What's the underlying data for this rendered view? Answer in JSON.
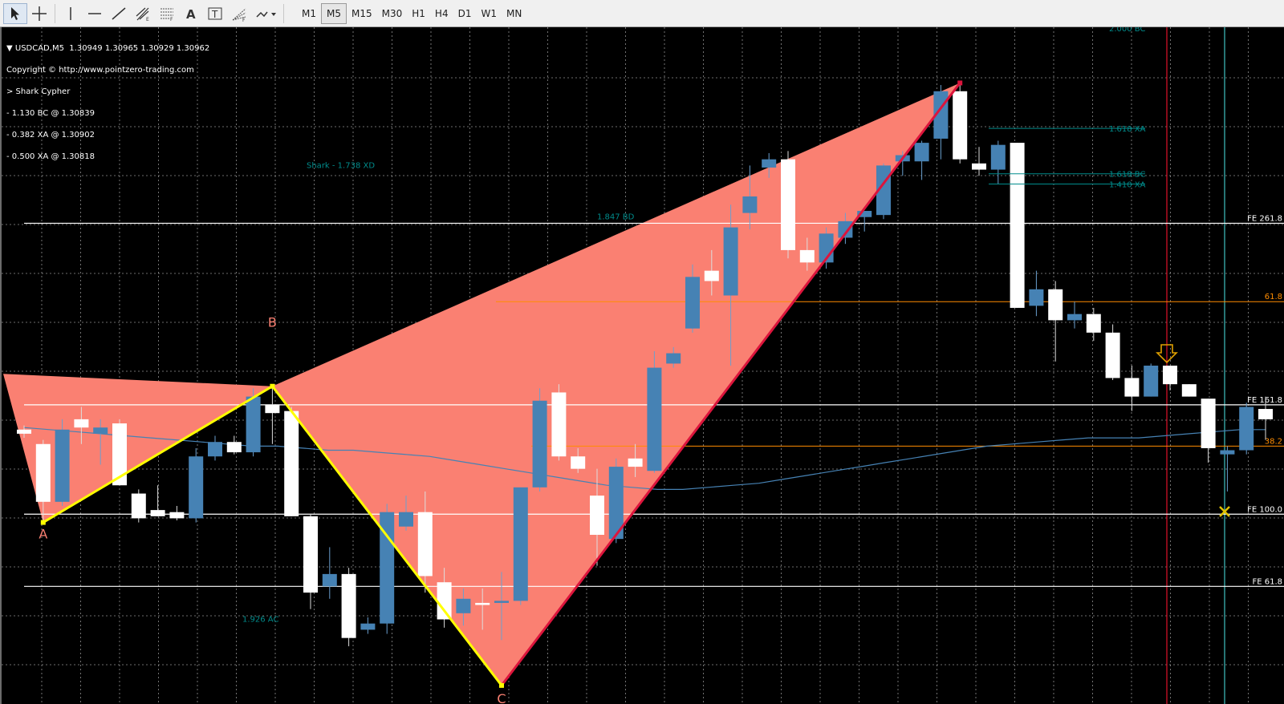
{
  "toolbar": {
    "tools": [
      {
        "name": "cursor-icon",
        "active": true
      },
      {
        "name": "crosshair-icon"
      },
      {
        "name": "sep"
      },
      {
        "name": "vertical-line-icon"
      },
      {
        "name": "horizontal-line-icon"
      },
      {
        "name": "trendline-icon"
      },
      {
        "name": "equidistant-channel-icon"
      },
      {
        "name": "fibonacci-retracement-icon"
      },
      {
        "name": "text-icon"
      },
      {
        "name": "text-label-icon"
      },
      {
        "name": "fibonacci-fan-icon"
      },
      {
        "name": "shapes-dropdown-icon"
      }
    ],
    "timeframes": [
      "M1",
      "M5",
      "M15",
      "M30",
      "H1",
      "H4",
      "D1",
      "W1",
      "MN"
    ],
    "active_timeframe": "M5"
  },
  "info": {
    "line1": "▼ USDCAD,M5  1.30949 1.30965 1.30929 1.30962",
    "line2": "Copyright © http://www.pointzero-trading.com",
    "line3": "> Shark Cypher",
    "line4": "- 1.130 BC @ 1.30839",
    "line5": "- 0.382 XA @ 1.30902",
    "line6": "- 0.500 XA @ 1.30818"
  },
  "pattern": {
    "labels": {
      "a": "A",
      "b": "B",
      "c": "C"
    },
    "ratios": {
      "xd": "Shark - 1.738 XD",
      "bd": "1.847 BD",
      "ac": "1.926 AC",
      "bc_top": "2.000 BC",
      "xa_1618": "1.618 XA",
      "bc_1618": "1.618 BC",
      "xa_1410": "1.410 XA"
    }
  },
  "levels": {
    "fe2618": "FE 261.8",
    "fe1618": "FE 161.8",
    "fe1000": "FE 100.0",
    "fe618": "FE 61.8",
    "fib618": "61.8",
    "fib382": "38.2"
  },
  "colors": {
    "bull": "#4682b4",
    "bear": "#ffffff",
    "pattern_fill": "#fa8072",
    "pattern_line": "#ffff00",
    "bd_line": "#dc143c",
    "ratio_text": "#008b8b",
    "fib_line": "#ff8c00",
    "grid": "#c0c0c0",
    "ma": "#4682b4"
  },
  "chart_data": {
    "type": "candlestick",
    "symbol": "USDCAD",
    "timeframe": "M5",
    "candles": [
      {
        "o": 1.30857,
        "h": 1.30859,
        "l": 1.30853,
        "c": 1.30855
      },
      {
        "o": 1.3085,
        "h": 1.30852,
        "l": 1.30812,
        "c": 1.30822
      },
      {
        "o": 1.30822,
        "h": 1.30862,
        "l": 1.3082,
        "c": 1.30857
      },
      {
        "o": 1.30862,
        "h": 1.30868,
        "l": 1.3085,
        "c": 1.30858
      },
      {
        "o": 1.30855,
        "h": 1.30862,
        "l": 1.3084,
        "c": 1.30858
      },
      {
        "o": 1.3086,
        "h": 1.30862,
        "l": 1.3083,
        "c": 1.3083
      },
      {
        "o": 1.30826,
        "h": 1.30828,
        "l": 1.30812,
        "c": 1.30814
      },
      {
        "o": 1.30818,
        "h": 1.3083,
        "l": 1.30815,
        "c": 1.30815
      },
      {
        "o": 1.30817,
        "h": 1.3082,
        "l": 1.30813,
        "c": 1.30814
      },
      {
        "o": 1.30814,
        "h": 1.30848,
        "l": 1.30812,
        "c": 1.30844
      },
      {
        "o": 1.30844,
        "h": 1.30854,
        "l": 1.30842,
        "c": 1.30851
      },
      {
        "o": 1.30851,
        "h": 1.30854,
        "l": 1.30845,
        "c": 1.30846
      },
      {
        "o": 1.30846,
        "h": 1.30877,
        "l": 1.30844,
        "c": 1.30873
      },
      {
        "o": 1.30869,
        "h": 1.30878,
        "l": 1.3085,
        "c": 1.30865
      },
      {
        "o": 1.30866,
        "h": 1.30868,
        "l": 1.30815,
        "c": 1.30815
      },
      {
        "o": 1.30815,
        "h": 1.30816,
        "l": 1.3077,
        "c": 1.30778
      },
      {
        "o": 1.30781,
        "h": 1.308,
        "l": 1.30775,
        "c": 1.30787
      },
      {
        "o": 1.30787,
        "h": 1.3079,
        "l": 1.30752,
        "c": 1.30756
      },
      {
        "o": 1.3076,
        "h": 1.30766,
        "l": 1.30758,
        "c": 1.30763
      },
      {
        "o": 1.30763,
        "h": 1.30821,
        "l": 1.30758,
        "c": 1.30817
      },
      {
        "o": 1.3081,
        "h": 1.30825,
        "l": 1.30808,
        "c": 1.30817
      },
      {
        "o": 1.30817,
        "h": 1.30827,
        "l": 1.30778,
        "c": 1.30786
      },
      {
        "o": 1.30783,
        "h": 1.3079,
        "l": 1.30761,
        "c": 1.30765
      },
      {
        "o": 1.30768,
        "h": 1.3078,
        "l": 1.30762,
        "c": 1.30775
      },
      {
        "o": 1.30773,
        "h": 1.3078,
        "l": 1.3076,
        "c": 1.30772
      },
      {
        "o": 1.30773,
        "h": 1.30788,
        "l": 1.30755,
        "c": 1.30774
      },
      {
        "o": 1.30774,
        "h": 1.30829,
        "l": 1.30772,
        "c": 1.30829
      },
      {
        "o": 1.30829,
        "h": 1.30877,
        "l": 1.30827,
        "c": 1.30871
      },
      {
        "o": 1.30875,
        "h": 1.30879,
        "l": 1.30842,
        "c": 1.30844
      },
      {
        "o": 1.30844,
        "h": 1.30848,
        "l": 1.30836,
        "c": 1.30838
      },
      {
        "o": 1.30825,
        "h": 1.30838,
        "l": 1.30791,
        "c": 1.30806
      },
      {
        "o": 1.30804,
        "h": 1.30843,
        "l": 1.30802,
        "c": 1.30839
      },
      {
        "o": 1.30843,
        "h": 1.3085,
        "l": 1.30834,
        "c": 1.30839
      },
      {
        "o": 1.30837,
        "h": 1.30895,
        "l": 1.30836,
        "c": 1.30887
      },
      {
        "o": 1.30889,
        "h": 1.30897,
        "l": 1.30887,
        "c": 1.30894
      },
      {
        "o": 1.30906,
        "h": 1.30937,
        "l": 1.30904,
        "c": 1.30931
      },
      {
        "o": 1.30934,
        "h": 1.30944,
        "l": 1.30922,
        "c": 1.30929
      },
      {
        "o": 1.30922,
        "h": 1.30966,
        "l": 1.30888,
        "c": 1.30955
      },
      {
        "o": 1.30962,
        "h": 1.30985,
        "l": 1.30954,
        "c": 1.3097
      },
      {
        "o": 1.30984,
        "h": 1.30991,
        "l": 1.30979,
        "c": 1.30988
      },
      {
        "o": 1.30988,
        "h": 1.30992,
        "l": 1.3094,
        "c": 1.30944
      },
      {
        "o": 1.30944,
        "h": 1.3095,
        "l": 1.30934,
        "c": 1.30938
      },
      {
        "o": 1.30938,
        "h": 1.30955,
        "l": 1.30935,
        "c": 1.30952
      },
      {
        "o": 1.3095,
        "h": 1.30962,
        "l": 1.30947,
        "c": 1.30958
      },
      {
        "o": 1.3096,
        "h": 1.30963,
        "l": 1.30953,
        "c": 1.30963
      },
      {
        "o": 1.30961,
        "h": 1.30986,
        "l": 1.30959,
        "c": 1.30985
      },
      {
        "o": 1.30987,
        "h": 1.30992,
        "l": 1.3098,
        "c": 1.3099
      },
      {
        "o": 1.30987,
        "h": 1.30997,
        "l": 1.30978,
        "c": 1.30996
      },
      {
        "o": 1.30998,
        "h": 1.31024,
        "l": 1.30988,
        "c": 1.31021
      },
      {
        "o": 1.31021,
        "h": 1.31025,
        "l": 1.30986,
        "c": 1.30988
      },
      {
        "o": 1.30986,
        "h": 1.30994,
        "l": 1.3098,
        "c": 1.30983
      },
      {
        "o": 1.30983,
        "h": 1.30997,
        "l": 1.30976,
        "c": 1.30995
      },
      {
        "o": 1.30996,
        "h": 1.30996,
        "l": 1.30916,
        "c": 1.30916
      },
      {
        "o": 1.30917,
        "h": 1.30934,
        "l": 1.30912,
        "c": 1.30925
      },
      {
        "o": 1.30925,
        "h": 1.30929,
        "l": 1.3089,
        "c": 1.3091
      },
      {
        "o": 1.3091,
        "h": 1.30919,
        "l": 1.30906,
        "c": 1.30913
      },
      {
        "o": 1.30913,
        "h": 1.30916,
        "l": 1.309,
        "c": 1.30904
      },
      {
        "o": 1.30904,
        "h": 1.30908,
        "l": 1.30881,
        "c": 1.30882
      },
      {
        "o": 1.30882,
        "h": 1.30888,
        "l": 1.30866,
        "c": 1.30873
      },
      {
        "o": 1.30873,
        "h": 1.30889,
        "l": 1.30873,
        "c": 1.30888
      },
      {
        "o": 1.30888,
        "h": 1.30888,
        "l": 1.30876,
        "c": 1.30879
      },
      {
        "o": 1.30879,
        "h": 1.30879,
        "l": 1.30873,
        "c": 1.30873
      },
      {
        "o": 1.30872,
        "h": 1.30872,
        "l": 1.30841,
        "c": 1.30848
      },
      {
        "o": 1.30845,
        "h": 1.30849,
        "l": 1.30827,
        "c": 1.30847
      },
      {
        "o": 1.30847,
        "h": 1.3087,
        "l": 1.30845,
        "c": 1.30868
      },
      {
        "o": 1.30867,
        "h": 1.30873,
        "l": 1.30852,
        "c": 1.30862
      }
    ],
    "ma_values": [
      1.30858,
      1.30857,
      1.30856,
      1.30855,
      1.30854,
      1.30853,
      1.30852,
      1.30851,
      1.3085,
      1.30849,
      1.30849,
      1.30848,
      1.30847,
      1.30847,
      1.30846,
      1.30845,
      1.30844,
      1.30842,
      1.3084,
      1.30838,
      1.30836,
      1.30834,
      1.30832,
      1.3083,
      1.30829,
      1.30828,
      1.30828,
      1.30829,
      1.3083,
      1.30831,
      1.30833,
      1.30835,
      1.30837,
      1.30839,
      1.30841,
      1.30843,
      1.30845,
      1.30847,
      1.30849,
      1.3085,
      1.30851,
      1.30852,
      1.30853,
      1.30853,
      1.30853,
      1.30854,
      1.30855,
      1.30856,
      1.30857,
      1.30857
    ],
    "pattern_points": {
      "X": {
        "index": -1,
        "price": 1.30884
      },
      "A": {
        "index": 1,
        "price": 1.30812
      },
      "B": {
        "index": 13,
        "price": 1.30878
      },
      "C": {
        "index": 25,
        "price": 1.30733
      },
      "D": {
        "index": 49,
        "price": 1.31025
      }
    },
    "level_prices": {
      "fe2618": 1.30957,
      "fe1618": 1.30869,
      "fe1000": 1.30816,
      "fe618": 1.30781,
      "fib618": 1.30919,
      "fib382": 1.30849,
      "xa_1618": 1.31003,
      "bc_1618": 1.30981,
      "xa_1410": 1.30976,
      "bd": 1.3096,
      "xd": 1.30985,
      "ac": 1.30765
    },
    "price_range": [
      1.30724,
      1.31052
    ],
    "grid": true
  }
}
